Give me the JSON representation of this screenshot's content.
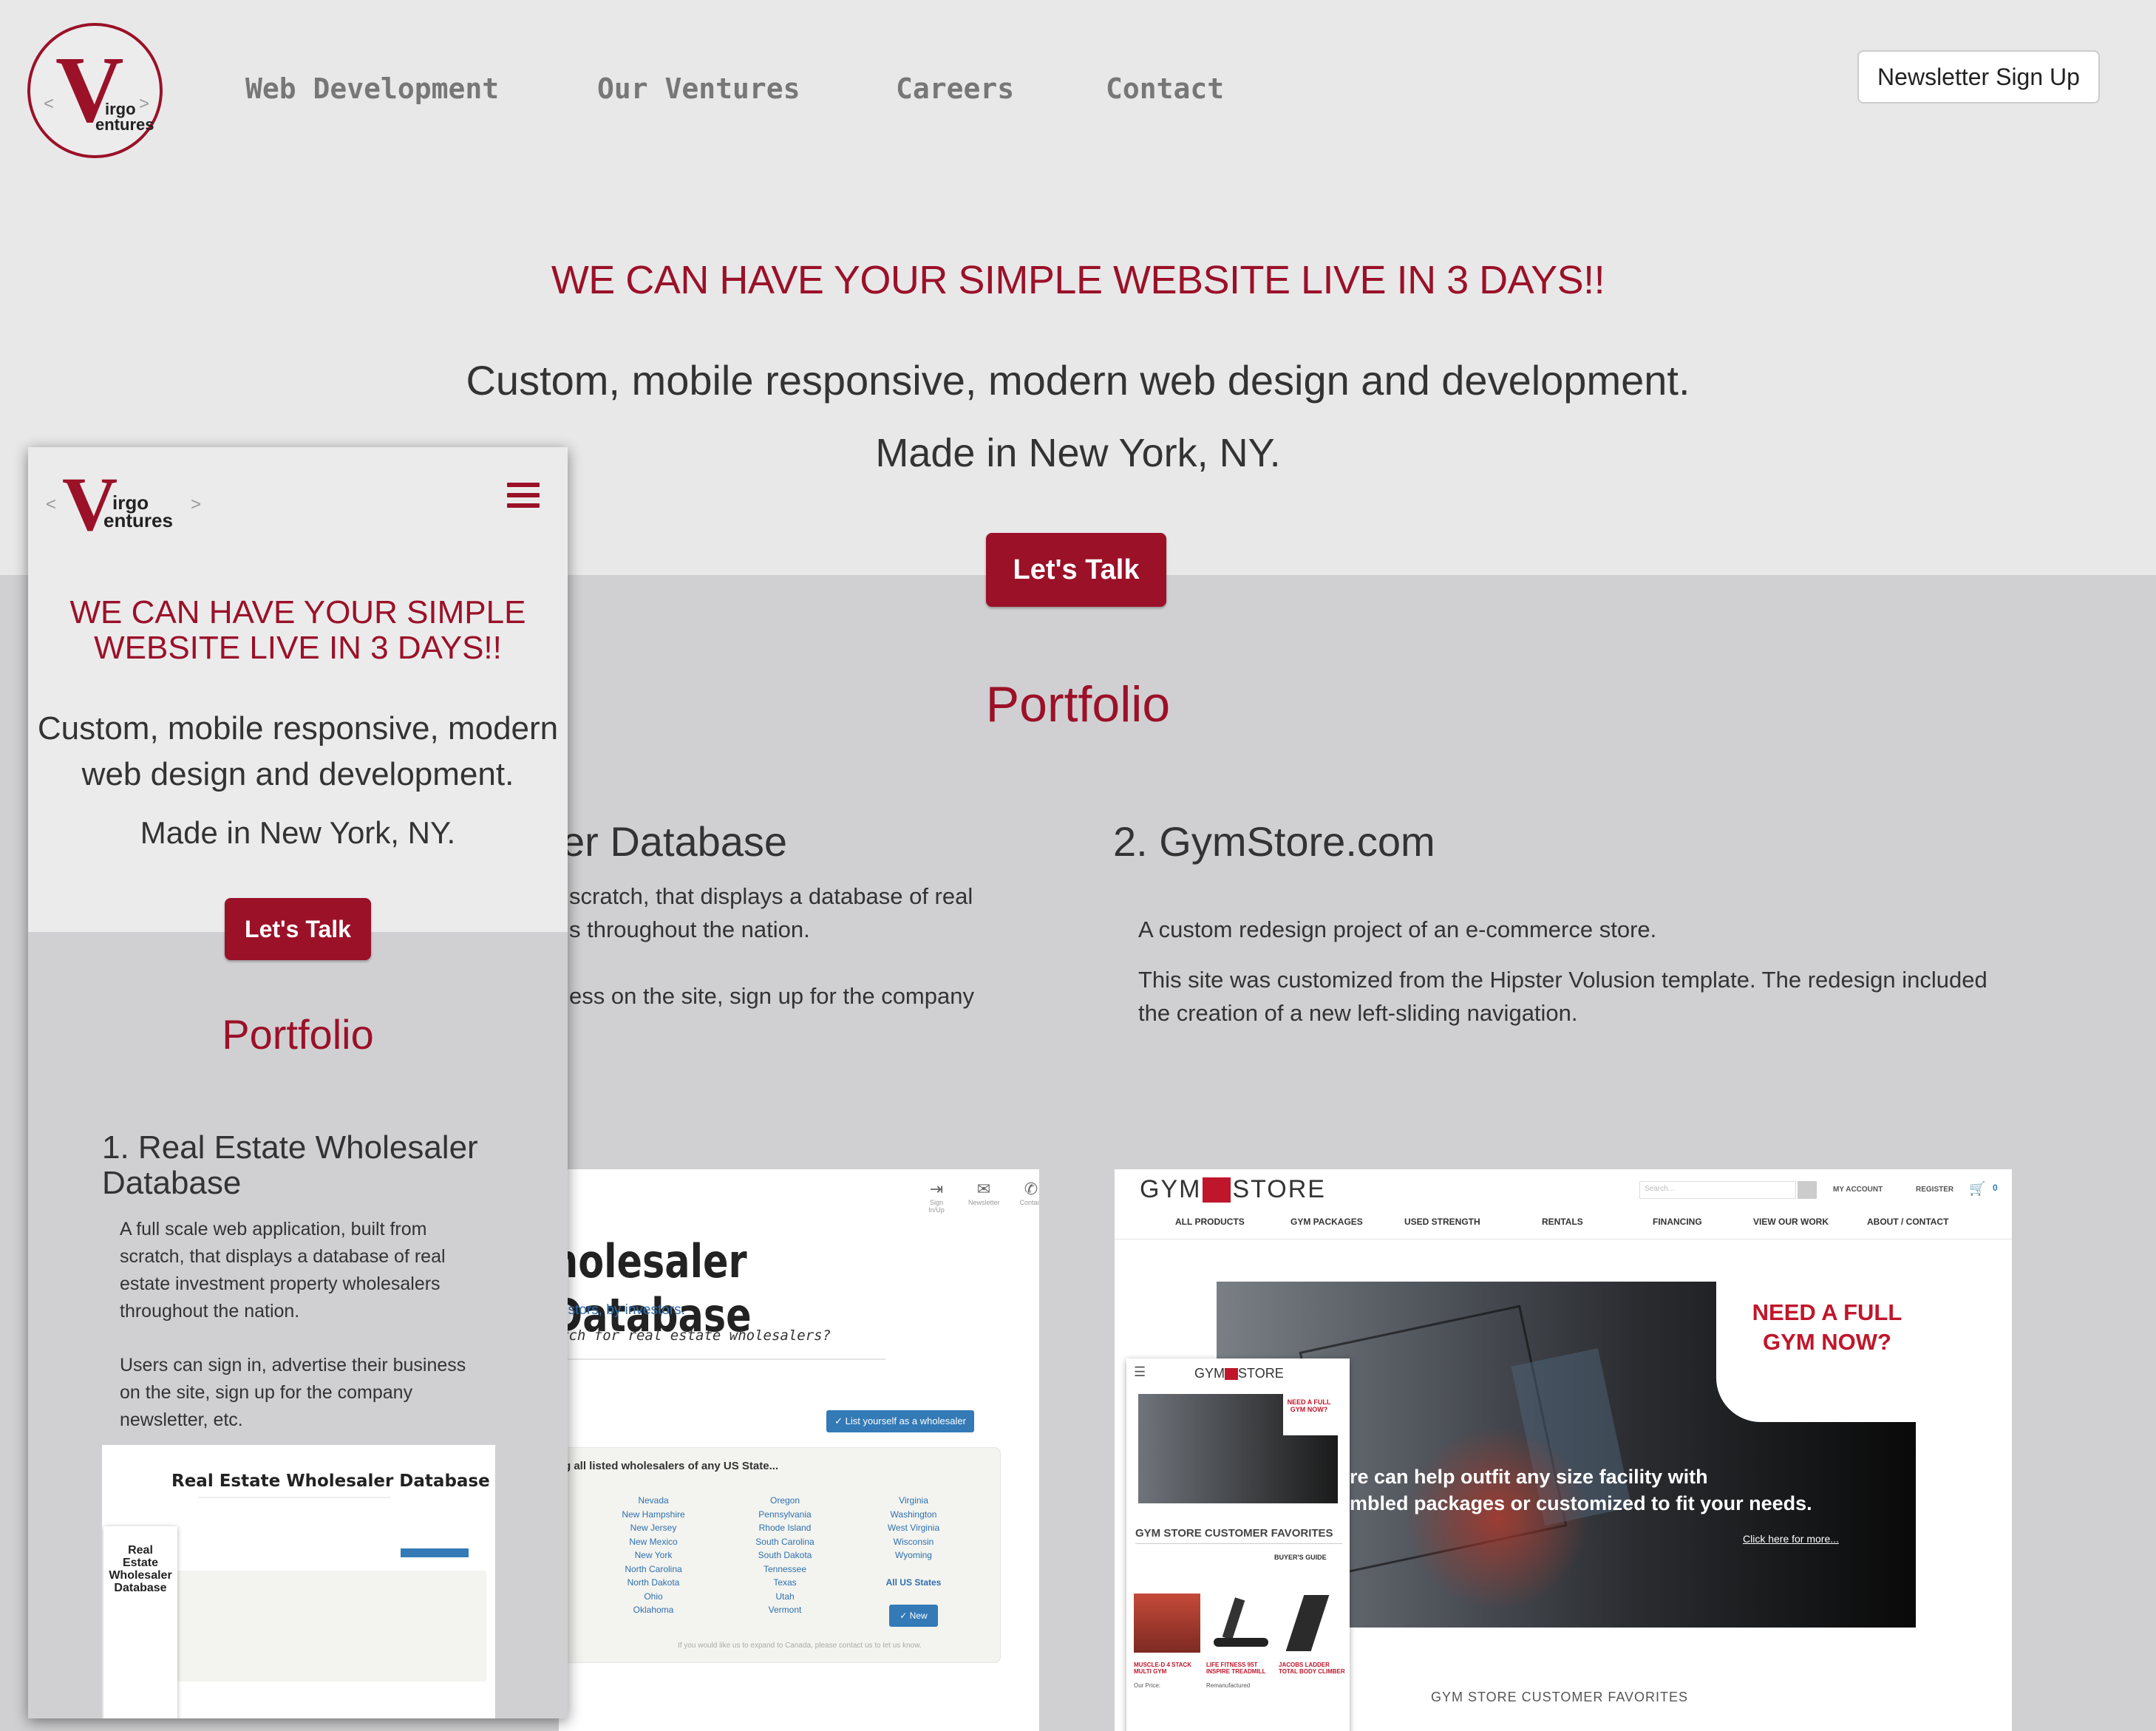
{
  "logo": {
    "letter": "V",
    "line1": "irgo",
    "line2": "entures",
    "lt": "<",
    "gt": ">"
  },
  "nav": {
    "items": [
      "Web Development",
      "Our Ventures",
      "Careers",
      "Contact"
    ],
    "newsletter": "Newsletter Sign Up"
  },
  "hero": {
    "headline": "WE CAN HAVE YOUR SIMPLE WEBSITE LIVE IN 3 DAYS!!",
    "sub1": "Custom, mobile responsive, modern web design and development.",
    "sub2": "Made in New York, NY.",
    "cta": "Let's Talk"
  },
  "portfolio": {
    "title": "Portfolio",
    "project1": {
      "title_partial": "er Database",
      "desc_line1": "scratch, that displays a database of real",
      "desc_line2": "s throughout the nation.",
      "desc_line3": "ess on the site, sign up for the company"
    },
    "project2": {
      "title": "2. GymStore.com",
      "desc1": "A custom redesign project of an e-commerce store.",
      "desc2_line1": "This site was customized from the Hipster Volusion template. The redesign included",
      "desc2_line2": "the creation of a new left-sliding navigation."
    }
  },
  "wholesaler_shot": {
    "heading": "holesaler Database",
    "tagline": "estors, by investors.",
    "question": "rch for real estate wholesalers?",
    "list_btn": "✓ List yourself as a wholesaler",
    "view_label": "g all listed wholesalers of any US State...",
    "icons": [
      "Sign In/Up",
      "Newsletter",
      "Contact"
    ],
    "states_col1": [
      "Nevada",
      "New Hampshire",
      "New Jersey",
      "New Mexico",
      "New York",
      "North Carolina",
      "North Dakota",
      "Ohio",
      "Oklahoma"
    ],
    "states_col2": [
      "Oregon",
      "Pennsylvania",
      "Rhode Island",
      "South Carolina",
      "South Dakota",
      "Tennessee",
      "Texas",
      "Utah",
      "Vermont"
    ],
    "states_col3": [
      "Virginia",
      "Washington",
      "West Virginia",
      "Wisconsin",
      "Wyoming",
      "",
      "All US States"
    ],
    "new_btn": "✓ New",
    "footer": "If you would like us to expand to Canada, please contact us to let us know."
  },
  "gym_shot": {
    "logo_left": "GYM",
    "logo_right": "STORE",
    "search_placeholder": "Search...",
    "account": "MY ACCOUNT",
    "register": "REGISTER",
    "cart_count": "0",
    "menu": [
      "ALL PRODUCTS",
      "GYM PACKAGES",
      "USED STRENGTH",
      "RENTALS",
      "FINANCING",
      "VIEW OUR WORK",
      "ABOUT / CONTACT"
    ],
    "banner_head1": "NEED A FULL",
    "banner_head2": "GYM NOW?",
    "banner_text1": "re can help outfit any size facility with",
    "banner_text2": "mbled packages or customized to fit your needs.",
    "banner_link": "Click here for more...",
    "favorites": "GYM STORE CUSTOMER FAVORITES",
    "mini_favorites": "GYM STORE CUSTOMER FAVORITES",
    "mini_guide": "BUYER'S GUIDE",
    "mini_need": "NEED A FULL GYM NOW?",
    "mini_products": [
      "MUSCLE-D 4 STACK MULTI GYM",
      "LIFE FITNESS 95T INSPIRE TREADMILL",
      "JACOBS LADDER TOTAL BODY CLIMBER"
    ],
    "mini_price": "Our Price:",
    "mini_reman": "Remanufactured"
  },
  "mobile": {
    "headline1": "WE CAN HAVE YOUR SIMPLE",
    "headline2": "WEBSITE LIVE IN 3 DAYS!!",
    "sub1a": "Custom, mobile responsive, modern",
    "sub1b": "web design and development.",
    "sub2": "Made in New York, NY.",
    "cta": "Let's Talk",
    "portfolio": "Portfolio",
    "proj_title1": "1. Real Estate Wholesaler",
    "proj_title2": "Database",
    "desc": [
      "A full scale web application, built from",
      "scratch, that displays a database of real",
      "estate investment property wholesalers",
      "throughout the nation."
    ],
    "desc2": [
      "Users can sign in, advertise their business",
      "on the site, sign up for the company",
      "newsletter, etc."
    ],
    "thumb_title": "Real Estate Wholesaler Database",
    "thumb_side": [
      "Real",
      "Estate",
      "Wholesaler",
      "Database"
    ]
  },
  "colors": {
    "brand": "#9b1128",
    "hero_bg": "#e8e8e9",
    "portfolio_bg": "#d0d0d2"
  }
}
